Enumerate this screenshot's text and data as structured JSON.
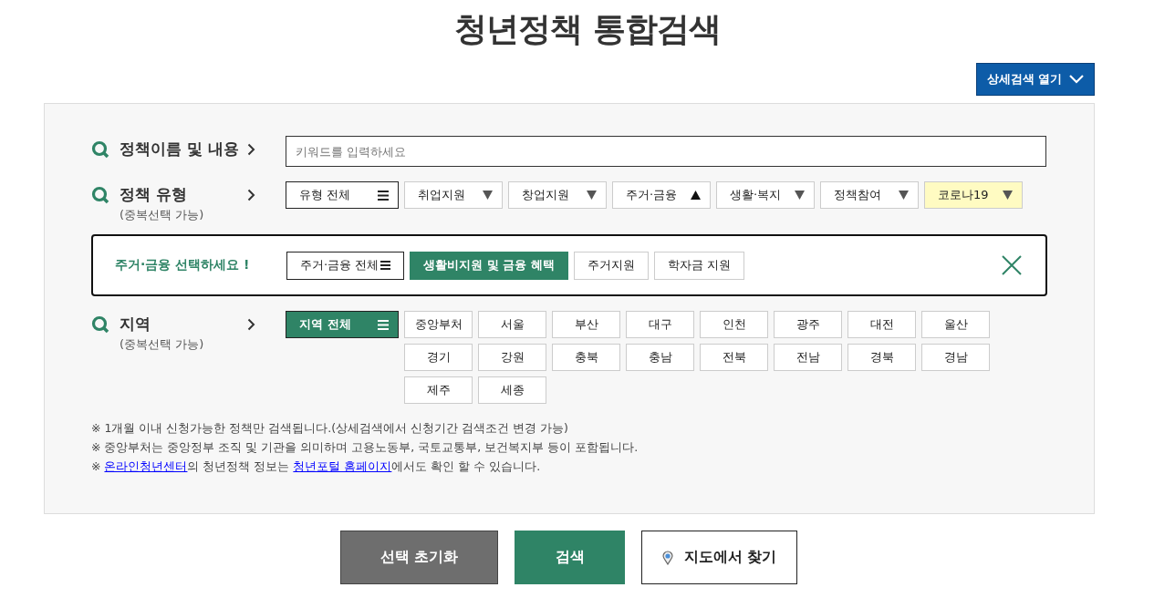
{
  "title": "청년정책 통합검색",
  "detail_button": {
    "label": "상세검색 열기",
    "expanded": false
  },
  "keyword": {
    "label": "정책이름 및 내용",
    "placeholder": "키워드를 입력하세요"
  },
  "policy_type": {
    "label": "정책 유형",
    "hint": "(중복선택 가능)",
    "items": [
      {
        "label": "유형 전체",
        "kind": "all",
        "expanded": false,
        "highlighted": false
      },
      {
        "label": "취업지원",
        "kind": "category",
        "expanded": false,
        "highlighted": false
      },
      {
        "label": "창업지원",
        "kind": "category",
        "expanded": false,
        "highlighted": false
      },
      {
        "label": "주거·금융",
        "kind": "category",
        "expanded": true,
        "highlighted": false
      },
      {
        "label": "생활·복지",
        "kind": "category",
        "expanded": false,
        "highlighted": false
      },
      {
        "label": "정책참여",
        "kind": "category",
        "expanded": false,
        "highlighted": false
      },
      {
        "label": "코로나19",
        "kind": "category",
        "expanded": false,
        "highlighted": true
      }
    ]
  },
  "sub_panel": {
    "prompt": "주거·금융 선택하세요 !",
    "options": [
      {
        "label": "주거·금융 전체",
        "kind": "all",
        "selected": false
      },
      {
        "label": "생활비지원 및 금융 혜택",
        "kind": "option",
        "selected": true
      },
      {
        "label": "주거지원",
        "kind": "option",
        "selected": false
      },
      {
        "label": "학자금 지원",
        "kind": "option",
        "selected": false
      }
    ]
  },
  "region": {
    "label": "지역",
    "hint": "(중복선택 가능)",
    "all": {
      "label": "지역 전체",
      "selected": true
    },
    "items": [
      {
        "label": "중앙부처",
        "selected": false
      },
      {
        "label": "서울",
        "selected": false
      },
      {
        "label": "부산",
        "selected": false
      },
      {
        "label": "대구",
        "selected": false
      },
      {
        "label": "인천",
        "selected": false
      },
      {
        "label": "광주",
        "selected": false
      },
      {
        "label": "대전",
        "selected": false
      },
      {
        "label": "울산",
        "selected": false
      },
      {
        "label": "경기",
        "selected": false
      },
      {
        "label": "강원",
        "selected": false
      },
      {
        "label": "충북",
        "selected": false
      },
      {
        "label": "충남",
        "selected": false
      },
      {
        "label": "전북",
        "selected": false
      },
      {
        "label": "전남",
        "selected": false
      },
      {
        "label": "경북",
        "selected": false
      },
      {
        "label": "경남",
        "selected": false
      },
      {
        "label": "제주",
        "selected": false
      },
      {
        "label": "세종",
        "selected": false
      }
    ]
  },
  "notes": [
    [
      {
        "text": "※ 1개월 이내 신청가능한 정책만 검색됩니다.(상세검색에서 신청기간 검색조건 변경 가능)",
        "link": false
      }
    ],
    [
      {
        "text": "※ 중앙부처는 중앙정부 조직 및 기관을 의미하며 고용노동부, 국토교통부, 보건복지부 등이 포함됩니다.",
        "link": false
      }
    ],
    [
      {
        "text": "※ ",
        "link": false
      },
      {
        "text": "온라인청년센터",
        "link": true
      },
      {
        "text": "의 청년정책 정보는 ",
        "link": false
      },
      {
        "text": "청년포털 홈페이지",
        "link": true
      },
      {
        "text": "에서도 확인 할 수 있습니다.",
        "link": false
      }
    ]
  ],
  "actions": [
    {
      "label": "선택 초기화",
      "kind": "reset"
    },
    {
      "label": "검색",
      "kind": "search"
    },
    {
      "label": "지도에서 찾기",
      "kind": "map"
    }
  ]
}
